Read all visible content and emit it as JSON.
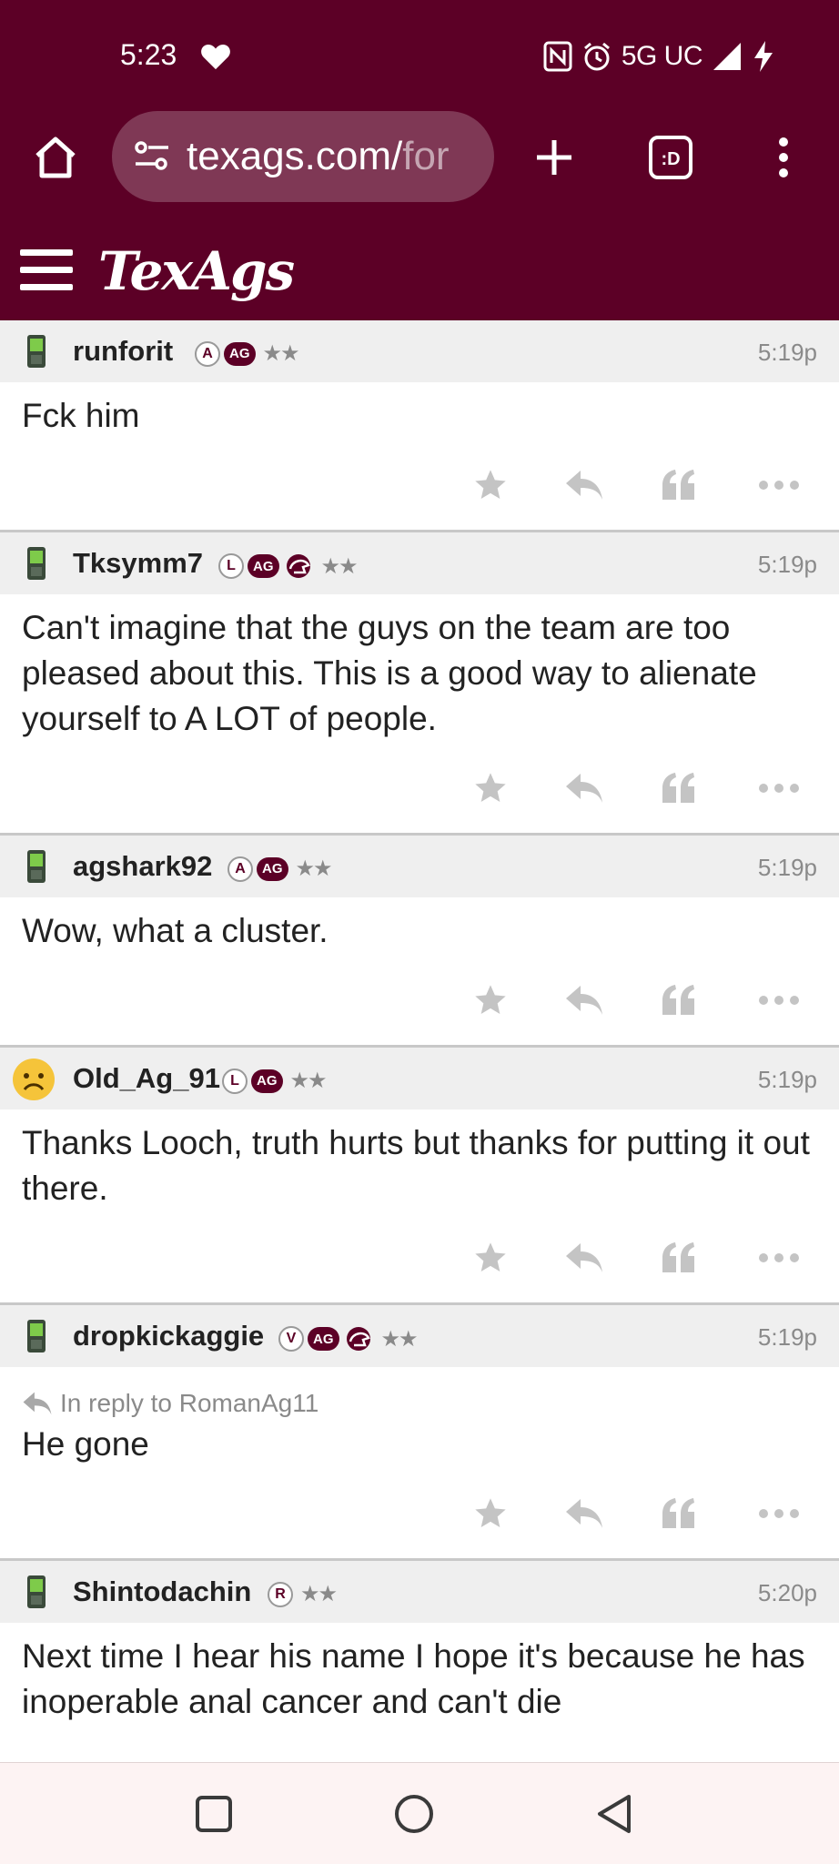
{
  "status": {
    "time": "5:23",
    "network": "5G UC"
  },
  "browser": {
    "url_main": "texags.com/",
    "url_dim": "for",
    "tab_count": ":D"
  },
  "site": {
    "logo": "TexAgs"
  },
  "posts": [
    {
      "username": "runforit",
      "badge_letter": "A",
      "badge_ag": "AG",
      "stars": "★★",
      "time": "5:19p",
      "reply_to": "",
      "body": "Fck him"
    },
    {
      "username": "Tksymm7",
      "badge_letter": "L",
      "badge_ag": "AG",
      "stars": "★★",
      "time": "5:19p",
      "reply_to": "",
      "body": "Can't imagine that the guys on the team are too pleased about this. This is a good way to alienate yourself to A LOT of people."
    },
    {
      "username": "agshark92",
      "badge_letter": "A",
      "badge_ag": "AG",
      "stars": "★★",
      "time": "5:19p",
      "reply_to": "",
      "body": "Wow, what a cluster."
    },
    {
      "username": "Old_Ag_91",
      "badge_letter": "L",
      "badge_ag": "AG",
      "stars": "★★",
      "time": "5:19p",
      "reply_to": "",
      "body": "Thanks Looch, truth hurts but thanks for putting it out there."
    },
    {
      "username": "dropkickaggie",
      "badge_letter": "V",
      "badge_ag": "AG",
      "stars": "★★",
      "time": "5:19p",
      "reply_to": "In reply to RomanAg11",
      "body": "He gone"
    },
    {
      "username": "Shintodachin",
      "badge_letter": "R",
      "badge_ag": "",
      "stars": "★★",
      "time": "5:20p",
      "reply_to": "",
      "body": "Next time I hear his name I hope it's because he has inoperable anal cancer and can't die"
    }
  ],
  "colors": {
    "brand": "#5c0026",
    "header_bg": "#efefef",
    "muted": "#8a8a8a"
  }
}
